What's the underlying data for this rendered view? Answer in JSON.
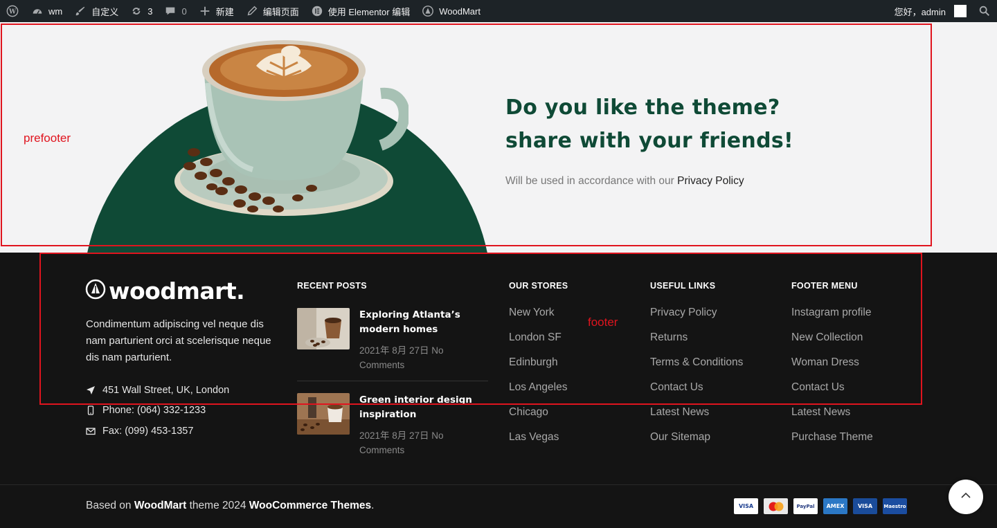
{
  "adminbar": {
    "site": "wm",
    "customize": "自定义",
    "updates": "3",
    "comments": "0",
    "new": "新建",
    "edit": "编辑页面",
    "elementor": "使用 Elementor 编辑",
    "woodmart": "WoodMart",
    "greeting": "您好，admin"
  },
  "prefooter": {
    "label": "prefooter",
    "title": "Do you like the theme? share with your friends!",
    "text": "Will be used in accordance with our",
    "link": "Privacy Policy",
    "circle_color": "#0f4a36"
  },
  "footer": {
    "label": "footer",
    "logo": "woodmart.",
    "about": "Condimentum adipiscing vel neque dis nam parturient orci at scelerisque neque dis nam parturient.",
    "contacts": [
      {
        "icon": "location-arrow-icon",
        "text": "451 Wall Street, UK, London"
      },
      {
        "icon": "phone-icon",
        "text": "Phone: (064) 332-1233"
      },
      {
        "icon": "envelope-icon",
        "text": "Fax: (099) 453-1357"
      }
    ],
    "recent_posts": {
      "title": "RECENT POSTS",
      "items": [
        {
          "title": "Exploring Atlanta’s modern homes",
          "meta": "2021年 8月 27日   No Comments"
        },
        {
          "title": "Green interior design inspiration",
          "meta": "2021年 8月 27日   No Comments"
        }
      ]
    },
    "stores": {
      "title": "OUR STORES",
      "items": [
        "New York",
        "London SF",
        "Edinburgh",
        "Los Angeles",
        "Chicago",
        "Las Vegas"
      ]
    },
    "useful": {
      "title": "USEFUL LINKS",
      "items": [
        "Privacy Policy",
        "Returns",
        "Terms & Conditions",
        "Contact Us",
        "Latest News",
        "Our Sitemap"
      ]
    },
    "menu": {
      "title": "FOOTER MENU",
      "items": [
        "Instagram profile",
        "New Collection",
        "Woman Dress",
        "Contact Us",
        "Latest News",
        "Purchase Theme"
      ]
    },
    "copyright": {
      "pre": "Based on",
      "brand": "WoodMart",
      "mid": "theme 2024",
      "company": "WooCommerce Themes",
      "end": "."
    },
    "payments": [
      "VISA",
      "MC",
      "PayPal",
      "AMEX",
      "VISA",
      "Maestro"
    ]
  }
}
